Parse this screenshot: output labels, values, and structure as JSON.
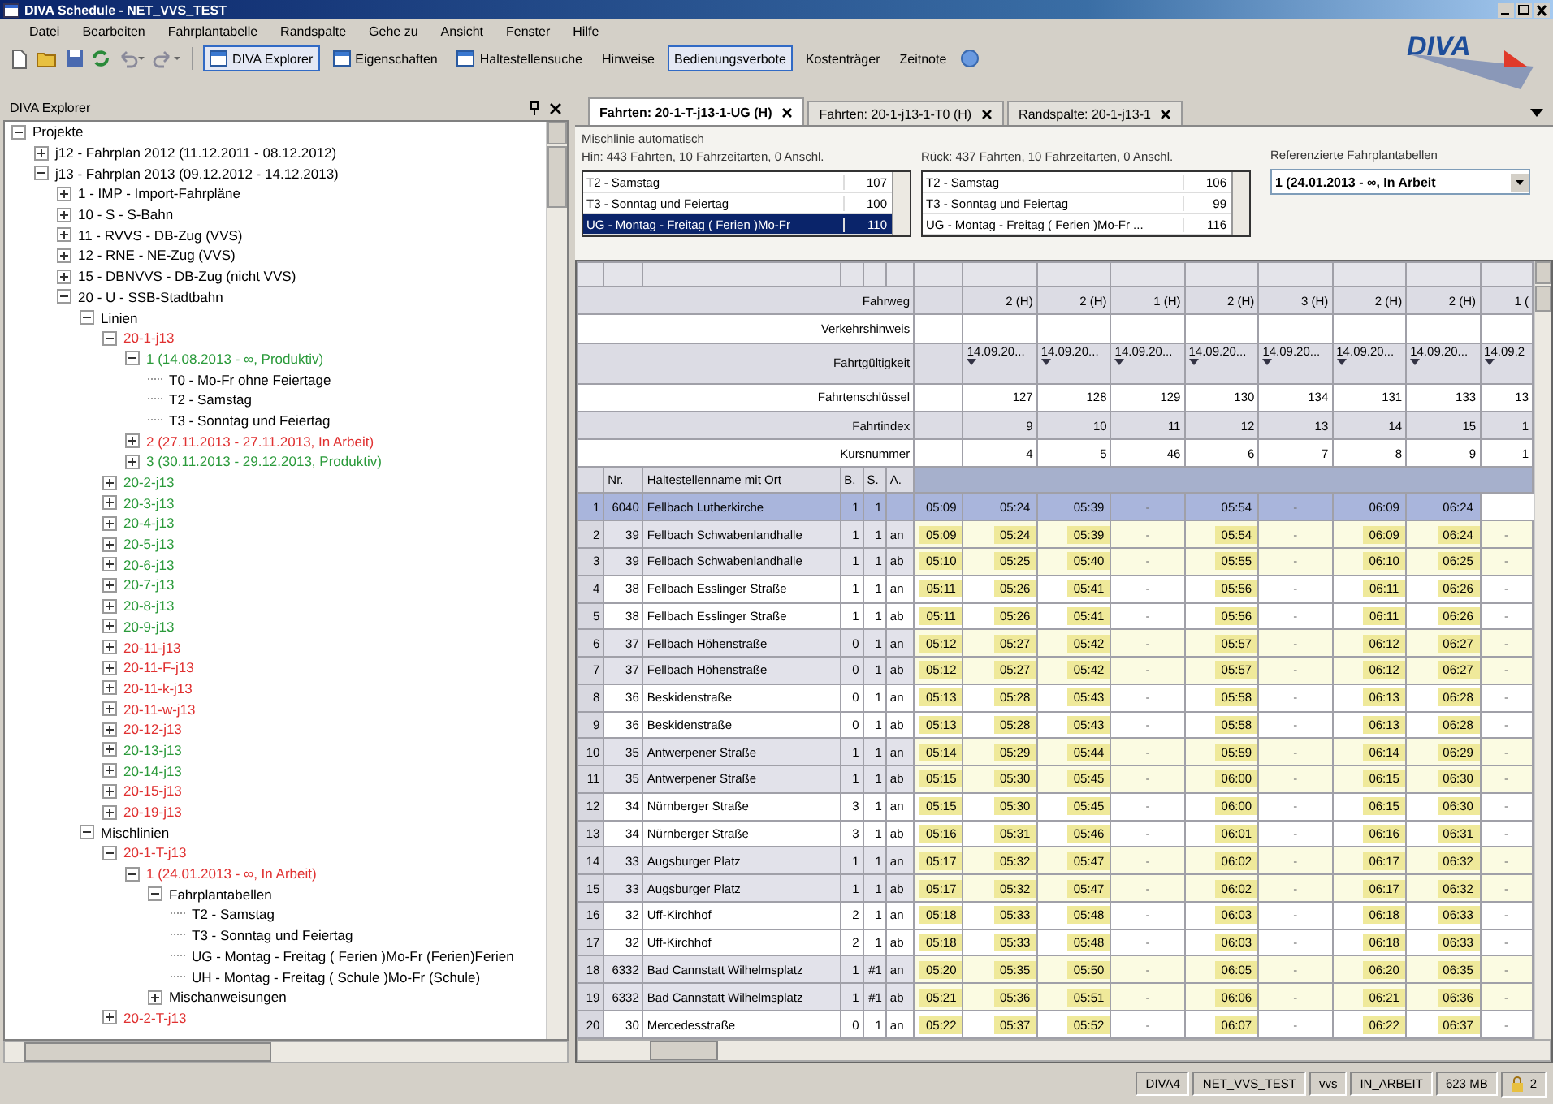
{
  "window": {
    "title": "DIVA Schedule - NET_VVS_TEST"
  },
  "menu": [
    "Datei",
    "Bearbeiten",
    "Fahrplantabelle",
    "Randspalte",
    "Gehe zu",
    "Ansicht",
    "Fenster",
    "Hilfe"
  ],
  "toolbar": [
    {
      "label": "DIVA Explorer",
      "kind": "with-icon",
      "pressed": true
    },
    {
      "label": "Eigenschaften",
      "kind": "with-icon",
      "pressed": false
    },
    {
      "label": "Haltestellensuche",
      "kind": "with-icon",
      "pressed": false
    },
    {
      "label": "Hinweise",
      "kind": "plain",
      "pressed": false
    },
    {
      "label": "Bedienungsverbote",
      "kind": "plain",
      "pressed": true
    },
    {
      "label": "Kostenträger",
      "kind": "plain",
      "pressed": false
    },
    {
      "label": "Zeitnote",
      "kind": "plain",
      "pressed": false
    }
  ],
  "logo": {
    "text": "DIVA"
  },
  "explorer": {
    "title": "DIVA Explorer",
    "tree": [
      {
        "label": "Projekte",
        "expanded": true,
        "children": [
          {
            "label": "j12 - Fahrplan 2012 (11.12.2011 - 08.12.2012)",
            "expanded": false
          },
          {
            "label": "j13 - Fahrplan 2013 (09.12.2012 - 14.12.2013)",
            "expanded": true,
            "children": [
              {
                "label": "1 - IMP - Import-Fahrpläne",
                "expanded": false
              },
              {
                "label": "10 - S - S-Bahn",
                "expanded": false
              },
              {
                "label": "11 - RVVS - DB-Zug (VVS)",
                "expanded": false
              },
              {
                "label": "12 - RNE - NE-Zug (VVS)",
                "expanded": false
              },
              {
                "label": "15 - DBNVVS - DB-Zug (nicht VVS)",
                "expanded": false
              },
              {
                "label": "20 - U - SSB-Stadtbahn",
                "expanded": true,
                "children": [
                  {
                    "label": "Linien",
                    "expanded": true,
                    "children": [
                      {
                        "label": "20-1-j13",
                        "color": "#e03030",
                        "expanded": true,
                        "children": [
                          {
                            "label": "1 (14.08.2013 - ∞, Produktiv)",
                            "color": "#2a9a3a",
                            "expanded": true,
                            "children": [
                              {
                                "label": "T0 - Mo-Fr ohne Feiertage"
                              },
                              {
                                "label": "T2 - Samstag"
                              },
                              {
                                "label": "T3 - Sonntag und Feiertag"
                              }
                            ]
                          },
                          {
                            "label": "2 (27.11.2013 - 27.11.2013, In Arbeit)",
                            "color": "#e03030",
                            "expanded": false
                          },
                          {
                            "label": "3 (30.11.2013 - 29.12.2013, Produktiv)",
                            "color": "#2a9a3a",
                            "expanded": false
                          }
                        ]
                      },
                      {
                        "label": "20-2-j13",
                        "color": "#2a9a3a",
                        "expanded": false
                      },
                      {
                        "label": "20-3-j13",
                        "color": "#2a9a3a",
                        "expanded": false
                      },
                      {
                        "label": "20-4-j13",
                        "color": "#2a9a3a",
                        "expanded": false
                      },
                      {
                        "label": "20-5-j13",
                        "color": "#2a9a3a",
                        "expanded": false
                      },
                      {
                        "label": "20-6-j13",
                        "color": "#2a9a3a",
                        "expanded": false
                      },
                      {
                        "label": "20-7-j13",
                        "color": "#2a9a3a",
                        "expanded": false
                      },
                      {
                        "label": "20-8-j13",
                        "color": "#2a9a3a",
                        "expanded": false
                      },
                      {
                        "label": "20-9-j13",
                        "color": "#2a9a3a",
                        "expanded": false
                      },
                      {
                        "label": "20-11-j13",
                        "color": "#e03030",
                        "expanded": false
                      },
                      {
                        "label": "20-11-F-j13",
                        "color": "#e03030",
                        "expanded": false
                      },
                      {
                        "label": "20-11-k-j13",
                        "color": "#e03030",
                        "expanded": false
                      },
                      {
                        "label": "20-11-w-j13",
                        "color": "#e03030",
                        "expanded": false
                      },
                      {
                        "label": "20-12-j13",
                        "color": "#e03030",
                        "expanded": false
                      },
                      {
                        "label": "20-13-j13",
                        "color": "#2a9a3a",
                        "expanded": false
                      },
                      {
                        "label": "20-14-j13",
                        "color": "#2a9a3a",
                        "expanded": false
                      },
                      {
                        "label": "20-15-j13",
                        "color": "#e03030",
                        "expanded": false
                      },
                      {
                        "label": "20-19-j13",
                        "color": "#e03030",
                        "expanded": false
                      }
                    ]
                  },
                  {
                    "label": "Mischlinien",
                    "expanded": true,
                    "children": [
                      {
                        "label": "20-1-T-j13",
                        "color": "#e03030",
                        "expanded": true,
                        "children": [
                          {
                            "label": "1 (24.01.2013 - ∞, In Arbeit)",
                            "color": "#e03030",
                            "expanded": true,
                            "children": [
                              {
                                "label": "Fahrplantabellen",
                                "expanded": true,
                                "children": [
                                  {
                                    "label": "T2 - Samstag"
                                  },
                                  {
                                    "label": "T3 - Sonntag und Feiertag"
                                  },
                                  {
                                    "label": "UG - Montag - Freitag ( Ferien )Mo-Fr (Ferien)Ferien"
                                  },
                                  {
                                    "label": "UH - Montag - Freitag ( Schule )Mo-Fr (Schule)"
                                  }
                                ]
                              },
                              {
                                "label": "Mischanweisungen",
                                "expanded": false
                              }
                            ]
                          }
                        ]
                      },
                      {
                        "label": "20-2-T-j13",
                        "color": "#e03030",
                        "expanded": false
                      }
                    ]
                  }
                ]
              }
            ]
          }
        ]
      }
    ]
  },
  "tabs": [
    {
      "label": "Fahrten: 20-1-T-j13-1-UG (H)",
      "selected": true
    },
    {
      "label": "Fahrten: 20-1-j13-1-T0 (H)",
      "selected": false
    },
    {
      "label": "Randspalte: 20-1-j13-1",
      "selected": false
    }
  ],
  "mix": {
    "title": "Mischlinie automatisch",
    "hin": "Hin: 443 Fahrten, 10 Fahrzeitarten, 0 Anschl.",
    "rueck": "Rück: 437 Fahrten, 10 Fahrzeitarten, 0 Anschl.",
    "hin_list": [
      {
        "label": "T2 - Samstag",
        "count": "107",
        "selected": false
      },
      {
        "label": "T3 - Sonntag und Feiertag",
        "count": "100",
        "selected": false
      },
      {
        "label": "UG - Montag - Freitag ( Ferien )Mo-Fr",
        "count": "110",
        "selected": true
      }
    ],
    "rueck_list": [
      {
        "label": "T2 - Samstag",
        "count": "106",
        "selected": false
      },
      {
        "label": "T3 - Sonntag und Feiertag",
        "count": "99",
        "selected": false
      },
      {
        "label": "UG - Montag - Freitag ( Ferien )Mo-Fr ...",
        "count": "116",
        "selected": false
      }
    ],
    "ref_label": "Referenzierte Fahrplantabellen",
    "ref_value": "1 (24.01.2013 - ∞, In Arbeit"
  },
  "grid": {
    "header_labels": [
      "Fahrweg",
      "Verkehrshinweis",
      "Fahrtgültigkeit",
      "Fahrtenschlüssel",
      "Fahrtindex",
      "Kursnummer"
    ],
    "trips": [
      {
        "fahrweg": "2 (H)",
        "gueltigkeit": "14.09.20...",
        "schluessel": "127",
        "index": "9",
        "kurs": "4"
      },
      {
        "fahrweg": "2 (H)",
        "gueltigkeit": "14.09.20...",
        "schluessel": "128",
        "index": "10",
        "kurs": "5"
      },
      {
        "fahrweg": "1 (H)",
        "gueltigkeit": "14.09.20...",
        "schluessel": "129",
        "index": "11",
        "kurs": "46"
      },
      {
        "fahrweg": "2 (H)",
        "gueltigkeit": "14.09.20...",
        "schluessel": "130",
        "index": "12",
        "kurs": "6"
      },
      {
        "fahrweg": "3 (H)",
        "gueltigkeit": "14.09.20...",
        "schluessel": "134",
        "index": "13",
        "kurs": "7"
      },
      {
        "fahrweg": "2 (H)",
        "gueltigkeit": "14.09.20...",
        "schluessel": "131",
        "index": "14",
        "kurs": "8"
      },
      {
        "fahrweg": "2 (H)",
        "gueltigkeit": "14.09.20...",
        "schluessel": "133",
        "index": "15",
        "kurs": "9"
      },
      {
        "fahrweg": "1 (",
        "gueltigkeit": "14.09.2",
        "schluessel": "13",
        "index": "1",
        "kurs": "1"
      }
    ],
    "columns": [
      "Nr.",
      "Haltestellenname mit Ort",
      "B.",
      "S.",
      "A."
    ],
    "rows": [
      {
        "n": "1",
        "nr": "6040",
        "name": "Fellbach Lutherkirche",
        "b": "1",
        "s": "1",
        "selected": true,
        "times": [
          "05:09",
          "05:24",
          "05:39",
          "-",
          "05:54",
          "-",
          "06:09",
          "06:24"
        ]
      },
      {
        "n": "2",
        "nr": "39",
        "name": "Fellbach Schwabenlandhalle",
        "b": "1",
        "s": "1",
        "a": "an",
        "selected": false,
        "times": [
          "05:09",
          "05:24",
          "05:39",
          "-",
          "05:54",
          "-",
          "06:09",
          "06:24",
          "-"
        ]
      },
      {
        "n": "3",
        "nr": "39",
        "name": "Fellbach Schwabenlandhalle",
        "b": "1",
        "s": "1",
        "a": "ab",
        "selected": false,
        "times": [
          "05:10",
          "05:25",
          "05:40",
          "-",
          "05:55",
          "-",
          "06:10",
          "06:25",
          "-"
        ]
      },
      {
        "n": "4",
        "nr": "38",
        "name": "Fellbach Esslinger Straße",
        "b": "1",
        "s": "1",
        "a": "an",
        "selected": false,
        "times": [
          "05:11",
          "05:26",
          "05:41",
          "-",
          "05:56",
          "-",
          "06:11",
          "06:26",
          "-"
        ]
      },
      {
        "n": "5",
        "nr": "38",
        "name": "Fellbach Esslinger Straße",
        "b": "1",
        "s": "1",
        "a": "ab",
        "selected": false,
        "times": [
          "05:11",
          "05:26",
          "05:41",
          "-",
          "05:56",
          "-",
          "06:11",
          "06:26",
          "-"
        ]
      },
      {
        "n": "6",
        "nr": "37",
        "name": "Fellbach Höhenstraße",
        "b": "0",
        "s": "1",
        "a": "an",
        "selected": false,
        "times": [
          "05:12",
          "05:27",
          "05:42",
          "-",
          "05:57",
          "-",
          "06:12",
          "06:27",
          "-"
        ]
      },
      {
        "n": "7",
        "nr": "37",
        "name": "Fellbach Höhenstraße",
        "b": "0",
        "s": "1",
        "a": "ab",
        "selected": false,
        "times": [
          "05:12",
          "05:27",
          "05:42",
          "-",
          "05:57",
          "-",
          "06:12",
          "06:27",
          "-"
        ]
      },
      {
        "n": "8",
        "nr": "36",
        "name": "Beskidenstraße",
        "b": "0",
        "s": "1",
        "a": "an",
        "selected": false,
        "times": [
          "05:13",
          "05:28",
          "05:43",
          "-",
          "05:58",
          "-",
          "06:13",
          "06:28",
          "-"
        ]
      },
      {
        "n": "9",
        "nr": "36",
        "name": "Beskidenstraße",
        "b": "0",
        "s": "1",
        "a": "ab",
        "selected": false,
        "times": [
          "05:13",
          "05:28",
          "05:43",
          "-",
          "05:58",
          "-",
          "06:13",
          "06:28",
          "-"
        ]
      },
      {
        "n": "10",
        "nr": "35",
        "name": "Antwerpener Straße",
        "b": "1",
        "s": "1",
        "a": "an",
        "selected": false,
        "times": [
          "05:14",
          "05:29",
          "05:44",
          "-",
          "05:59",
          "-",
          "06:14",
          "06:29",
          "-"
        ]
      },
      {
        "n": "11",
        "nr": "35",
        "name": "Antwerpener Straße",
        "b": "1",
        "s": "1",
        "a": "ab",
        "selected": false,
        "times": [
          "05:15",
          "05:30",
          "05:45",
          "-",
          "06:00",
          "-",
          "06:15",
          "06:30",
          "-"
        ]
      },
      {
        "n": "12",
        "nr": "34",
        "name": "Nürnberger Straße",
        "b": "3",
        "s": "1",
        "a": "an",
        "selected": false,
        "times": [
          "05:15",
          "05:30",
          "05:45",
          "-",
          "06:00",
          "-",
          "06:15",
          "06:30",
          "-"
        ]
      },
      {
        "n": "13",
        "nr": "34",
        "name": "Nürnberger Straße",
        "b": "3",
        "s": "1",
        "a": "ab",
        "selected": false,
        "times": [
          "05:16",
          "05:31",
          "05:46",
          "-",
          "06:01",
          "-",
          "06:16",
          "06:31",
          "-"
        ]
      },
      {
        "n": "14",
        "nr": "33",
        "name": "Augsburger Platz",
        "b": "1",
        "s": "1",
        "a": "an",
        "selected": false,
        "times": [
          "05:17",
          "05:32",
          "05:47",
          "-",
          "06:02",
          "-",
          "06:17",
          "06:32",
          "-"
        ]
      },
      {
        "n": "15",
        "nr": "33",
        "name": "Augsburger Platz",
        "b": "1",
        "s": "1",
        "a": "ab",
        "selected": false,
        "times": [
          "05:17",
          "05:32",
          "05:47",
          "-",
          "06:02",
          "-",
          "06:17",
          "06:32",
          "-"
        ]
      },
      {
        "n": "16",
        "nr": "32",
        "name": "Uff-Kirchhof",
        "b": "2",
        "s": "1",
        "a": "an",
        "selected": false,
        "times": [
          "05:18",
          "05:33",
          "05:48",
          "-",
          "06:03",
          "-",
          "06:18",
          "06:33",
          "-"
        ]
      },
      {
        "n": "17",
        "nr": "32",
        "name": "Uff-Kirchhof",
        "b": "2",
        "s": "1",
        "a": "ab",
        "selected": false,
        "times": [
          "05:18",
          "05:33",
          "05:48",
          "-",
          "06:03",
          "-",
          "06:18",
          "06:33",
          "-"
        ]
      },
      {
        "n": "18",
        "nr": "6332",
        "name": "Bad Cannstatt Wilhelmsplatz",
        "b": "1",
        "s": "#1",
        "a": "an",
        "selected": false,
        "times": [
          "05:20",
          "05:35",
          "05:50",
          "-",
          "06:05",
          "-",
          "06:20",
          "06:35",
          "-"
        ]
      },
      {
        "n": "19",
        "nr": "6332",
        "name": "Bad Cannstatt Wilhelmsplatz",
        "b": "1",
        "s": "#1",
        "a": "ab",
        "selected": false,
        "times": [
          "05:21",
          "05:36",
          "05:51",
          "-",
          "06:06",
          "-",
          "06:21",
          "06:36",
          "-"
        ]
      },
      {
        "n": "20",
        "nr": "30",
        "name": "Mercedesstraße",
        "b": "0",
        "s": "1",
        "a": "an",
        "selected": false,
        "times": [
          "05:22",
          "05:37",
          "05:52",
          "-",
          "06:07",
          "-",
          "06:22",
          "06:37",
          "-"
        ]
      }
    ]
  },
  "status_bar": {
    "segments": [
      "DIVA4",
      "NET_VVS_TEST",
      "vvs",
      "IN_ARBEIT",
      "623 MB"
    ],
    "lock_count": "2"
  }
}
